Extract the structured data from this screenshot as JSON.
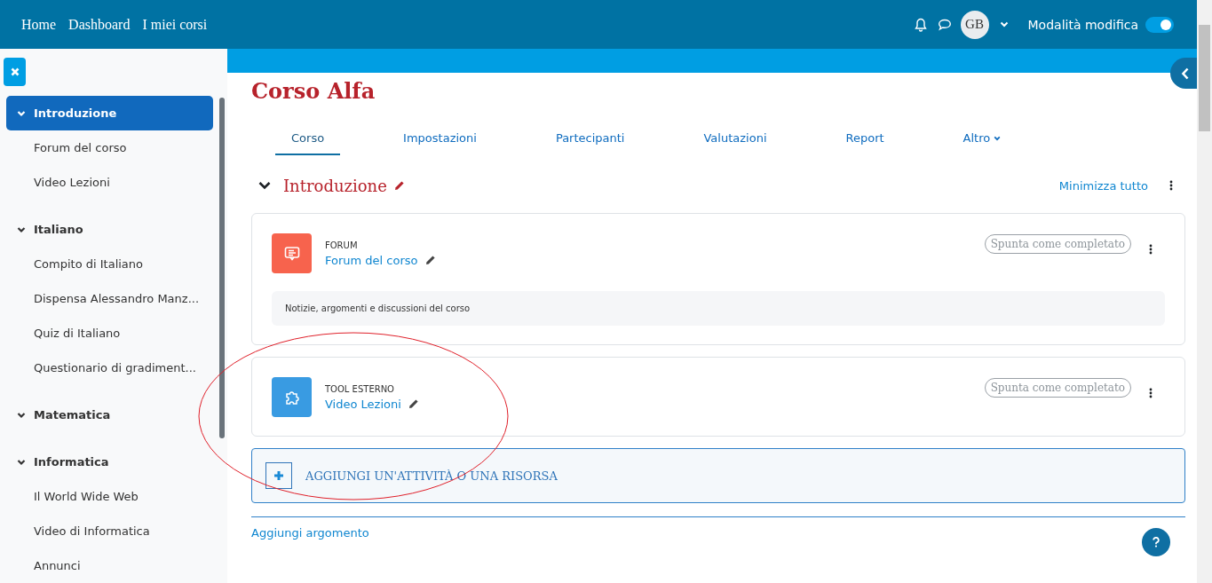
{
  "navbar": {
    "links": [
      "Home",
      "Dashboard",
      "I miei corsi"
    ],
    "user_initials": "GB",
    "edit_mode": {
      "label": "Modalità modifica",
      "on": true
    }
  },
  "sidebar": {
    "sections": [
      {
        "title": "Introduzione",
        "expanded": true,
        "selected": true,
        "children": [
          {
            "label": "Forum del corso"
          },
          {
            "label": "Video Lezioni"
          }
        ]
      },
      {
        "title": "Italiano",
        "expanded": true,
        "selected": false,
        "children": [
          {
            "label": "Compito di Italiano"
          },
          {
            "label": "Dispensa Alessandro Manz..."
          },
          {
            "label": "Quiz di Italiano"
          },
          {
            "label": "Questionario di gradiment..."
          }
        ]
      },
      {
        "title": "Matematica",
        "expanded": true,
        "selected": false
      },
      {
        "title": "Informatica",
        "expanded": true,
        "selected": false,
        "children": [
          {
            "label": "Il World Wide Web"
          },
          {
            "label": "Video di Informatica"
          },
          {
            "label": "Annunci"
          }
        ]
      }
    ]
  },
  "course": {
    "title": "Corso Alfa",
    "tabs": [
      {
        "label": "Corso",
        "selected": true,
        "dropdown": false
      },
      {
        "label": "Impostazioni",
        "selected": false,
        "dropdown": false
      },
      {
        "label": "Partecipanti",
        "selected": false,
        "dropdown": false
      },
      {
        "label": "Valutazioni",
        "selected": false,
        "dropdown": false
      },
      {
        "label": "Report",
        "selected": false,
        "dropdown": false
      },
      {
        "label": "Altro",
        "selected": false,
        "dropdown": true
      }
    ],
    "section": {
      "title": "Introduzione",
      "expanded": true,
      "collapse_all": "Minimizza tutto",
      "activities": [
        {
          "kind": "forum",
          "type": "FORUM",
          "name": "Forum del corso",
          "completion": "Spunta come completato",
          "description": "Notizie, argomenti e discussioni del corso"
        },
        {
          "kind": "external_tool",
          "type": "TOOL ESTERNO",
          "name": "Video Lezioni",
          "completion": "Spunta come completato"
        }
      ],
      "add_activity": "AGGIUNGI UN'ATTIVITÀ O UNA RISORSA"
    },
    "add_topic": "Aggiungi argomento"
  }
}
